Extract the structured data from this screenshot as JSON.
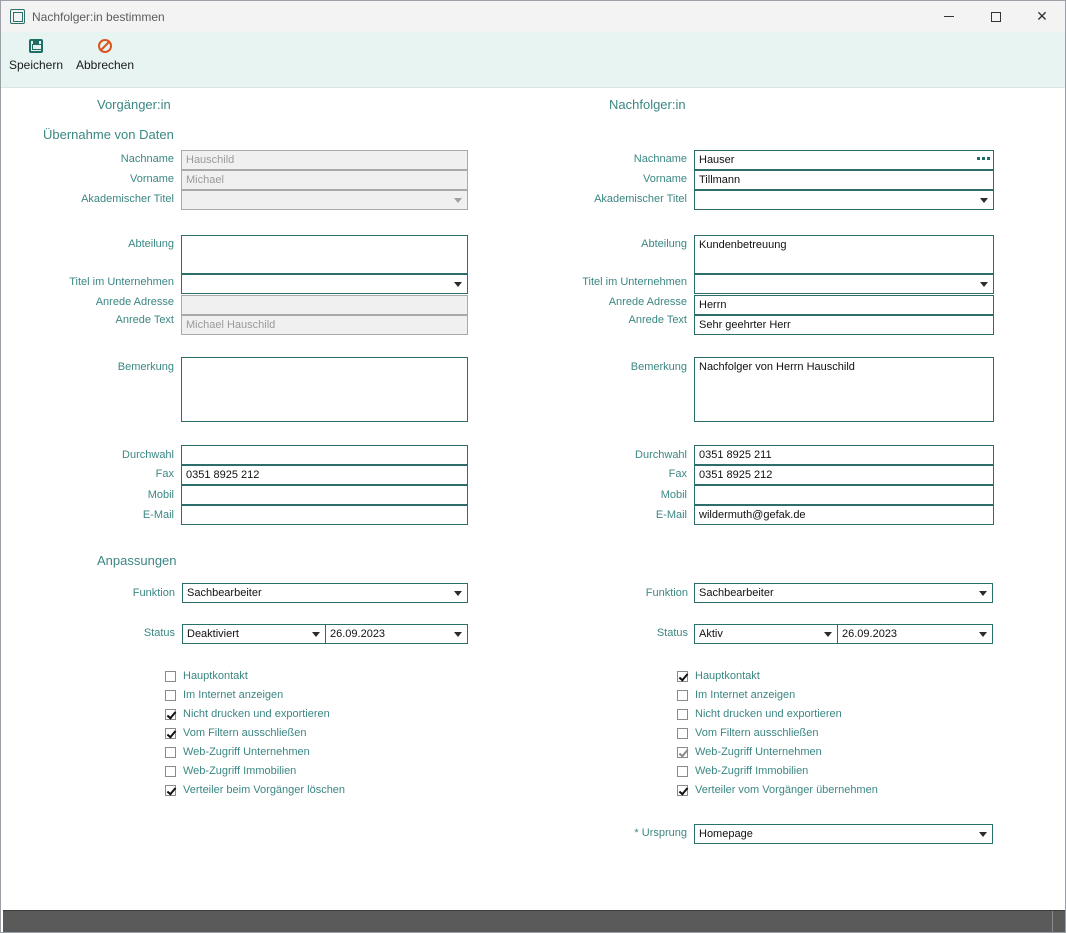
{
  "window": {
    "title": "Nachfolger:in bestimmen"
  },
  "toolbar": {
    "save_label": "Speichern",
    "cancel_label": "Abbrechen"
  },
  "headings": {
    "predecessor": "Vorgänger:in",
    "successor": "Nachfolger:in",
    "data_takeover": "Übernahme von Daten",
    "adjustments": "Anpassungen"
  },
  "labels": {
    "nachname": "Nachname",
    "vorname": "Vorname",
    "titel": "Akademischer Titel",
    "abteilung": "Abteilung",
    "titel_unternehmen": "Titel im Unternehmen",
    "anrede_adresse": "Anrede Adresse",
    "anrede_text": "Anrede Text",
    "bemerkung": "Bemerkung",
    "durchwahl": "Durchwahl",
    "fax": "Fax",
    "mobil": "Mobil",
    "email": "E-Mail",
    "funktion": "Funktion",
    "status": "Status",
    "ursprung": "* Ursprung"
  },
  "predecessor": {
    "nachname": "Hauschild",
    "vorname": "Michael",
    "titel": "",
    "abteilung": "",
    "titel_unternehmen": "",
    "anrede_adresse": "",
    "anrede_text": "Michael Hauschild",
    "bemerkung": "",
    "durchwahl": "",
    "fax": "0351 8925 212",
    "mobil": "",
    "email": "",
    "funktion": "Sachbearbeiter",
    "status": "Deaktiviert",
    "status_date": "26.09.2023",
    "checkboxes": [
      {
        "label": "Hauptkontakt",
        "checked": false
      },
      {
        "label": "Im Internet anzeigen",
        "checked": false
      },
      {
        "label": "Nicht drucken und exportieren",
        "checked": true
      },
      {
        "label": "Vom Filtern ausschließen",
        "checked": true
      },
      {
        "label": "Web-Zugriff Unternehmen",
        "checked": false
      },
      {
        "label": "Web-Zugriff Immobilien",
        "checked": false
      },
      {
        "label": "Verteiler beim Vorgänger löschen",
        "checked": true
      }
    ]
  },
  "successor": {
    "nachname": "Hauser",
    "vorname": "Tillmann",
    "titel": "",
    "abteilung": "Kundenbetreuung",
    "titel_unternehmen": "",
    "anrede_adresse": "Herrn",
    "anrede_text": "Sehr geehrter Herr",
    "bemerkung": "Nachfolger von Herrn Hauschild",
    "durchwahl": "0351 8925 211",
    "fax": "0351 8925 212",
    "mobil": "",
    "email": "wildermuth@gefak.de",
    "funktion": "Sachbearbeiter",
    "status": "Aktiv",
    "status_date": "26.09.2023",
    "ursprung": "Homepage",
    "checkboxes": [
      {
        "label": "Hauptkontakt",
        "checked": true
      },
      {
        "label": "Im Internet anzeigen",
        "checked": false
      },
      {
        "label": "Nicht drucken und exportieren",
        "checked": false
      },
      {
        "label": "Vom Filtern ausschließen",
        "checked": false
      },
      {
        "label": "Web-Zugriff Unternehmen",
        "checked": true,
        "disabled": true
      },
      {
        "label": "Web-Zugriff Immobilien",
        "checked": false
      },
      {
        "label": "Verteiler vom Vorgänger übernehmen",
        "checked": true
      }
    ]
  }
}
